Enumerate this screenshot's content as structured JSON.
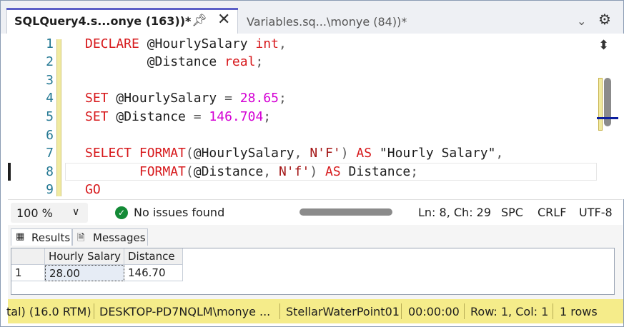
{
  "tabs": [
    {
      "title": "SQLQuery4.s...onye (163))*",
      "active": true
    },
    {
      "title": "Variables.sq...\\monye (84))*",
      "active": false
    }
  ],
  "tab_icons": {
    "pin": "pin-icon",
    "close": "close-icon",
    "overflow": "chevron-down-icon",
    "settings": "gear-icon"
  },
  "editor": {
    "line_numbers": [
      "1",
      "2",
      "3",
      "4",
      "5",
      "6",
      "7",
      "8",
      "9"
    ],
    "lines": [
      [
        {
          "t": "DECLARE",
          "c": "kw"
        },
        {
          "t": " @HourlySalary ",
          "c": ""
        },
        {
          "t": "int",
          "c": "kw"
        },
        {
          "t": ",",
          "c": "op"
        }
      ],
      [
        {
          "t": "        @Distance ",
          "c": ""
        },
        {
          "t": "real",
          "c": "kw"
        },
        {
          "t": ";",
          "c": "op"
        }
      ],
      [],
      [
        {
          "t": "SET",
          "c": "kw"
        },
        {
          "t": " @HourlySalary ",
          "c": ""
        },
        {
          "t": "=",
          "c": "op"
        },
        {
          "t": " ",
          "c": ""
        },
        {
          "t": "28.65",
          "c": "num"
        },
        {
          "t": ";",
          "c": "op"
        }
      ],
      [
        {
          "t": "SET",
          "c": "kw"
        },
        {
          "t": " @Distance ",
          "c": ""
        },
        {
          "t": "=",
          "c": "op"
        },
        {
          "t": " ",
          "c": ""
        },
        {
          "t": "146.704",
          "c": "num"
        },
        {
          "t": ";",
          "c": "op"
        }
      ],
      [],
      [
        {
          "t": "SELECT",
          "c": "kw"
        },
        {
          "t": " ",
          "c": ""
        },
        {
          "t": "FORMAT",
          "c": "kw"
        },
        {
          "t": "(",
          "c": "op"
        },
        {
          "t": "@HourlySalary",
          "c": ""
        },
        {
          "t": ",",
          "c": "op"
        },
        {
          "t": " ",
          "c": ""
        },
        {
          "t": "N'F'",
          "c": "str"
        },
        {
          "t": ")",
          "c": "op"
        },
        {
          "t": " ",
          "c": ""
        },
        {
          "t": "AS",
          "c": "kw"
        },
        {
          "t": " \"Hourly Salary\"",
          "c": ""
        },
        {
          "t": ",",
          "c": "op"
        }
      ],
      [
        {
          "t": "       ",
          "c": ""
        },
        {
          "t": "FORMAT",
          "c": "kw"
        },
        {
          "t": "(",
          "c": "op"
        },
        {
          "t": "@Distance",
          "c": ""
        },
        {
          "t": ",",
          "c": "op"
        },
        {
          "t": " ",
          "c": ""
        },
        {
          "t": "N'f'",
          "c": "str"
        },
        {
          "t": ")",
          "c": "op"
        },
        {
          "t": " ",
          "c": ""
        },
        {
          "t": "AS",
          "c": "kw"
        },
        {
          "t": " Distance",
          "c": ""
        },
        {
          "t": ";",
          "c": "op"
        }
      ],
      [
        {
          "t": "GO",
          "c": "kw"
        }
      ]
    ]
  },
  "editor_status": {
    "zoom": "100 %",
    "issues": "No issues found",
    "position": "Ln: 8, Ch: 29",
    "whitespace": "SPC",
    "eol": "CRLF",
    "encoding": "UTF-8"
  },
  "results": {
    "tabs": [
      {
        "label": "Results",
        "icon": "grid-icon",
        "active": true
      },
      {
        "label": "Messages",
        "icon": "messages-icon",
        "active": false
      }
    ],
    "columns": [
      "Hourly Salary",
      "Distance"
    ],
    "rows": [
      {
        "num": "1",
        "cells": [
          "28.00",
          "146.70"
        ]
      }
    ]
  },
  "connection_bar": {
    "version": "tal) (16.0 RTM)",
    "user": "DESKTOP-PD7NQLM\\monye ...",
    "database": "StellarWaterPoint01",
    "elapsed": "00:00:00",
    "rowcol": "Row: 1, Col: 1",
    "rows": "1 rows"
  },
  "colors": {
    "keyword": "#d7191c",
    "string": "#a31515",
    "number": "#d400d4",
    "line_number": "#237893",
    "status_bar": "#f5ec8a",
    "accent": "#5b5fc7"
  }
}
